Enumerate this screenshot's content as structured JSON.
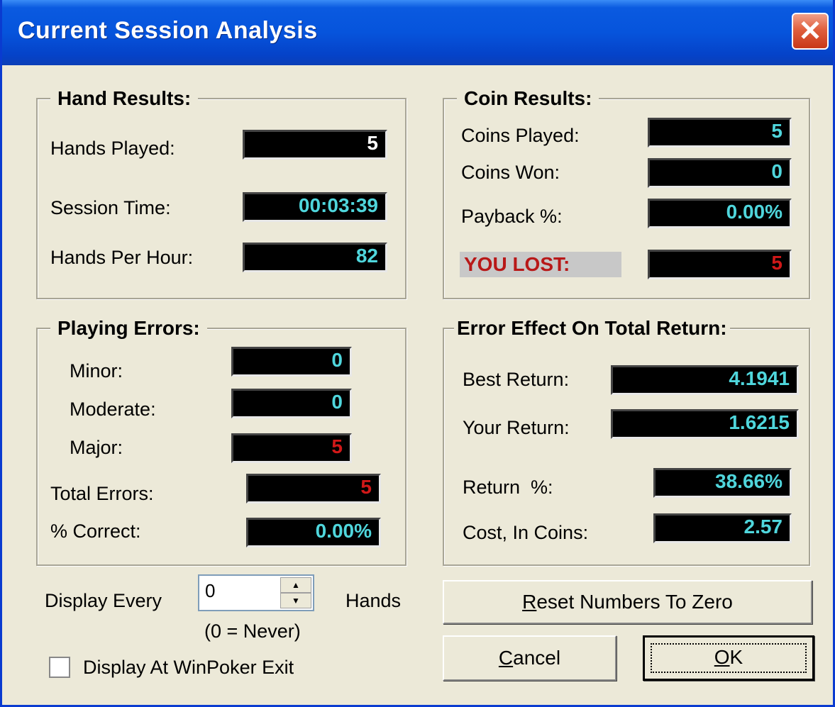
{
  "window": {
    "title": "Current Session Analysis"
  },
  "hand_results": {
    "title": "Hand Results:",
    "hands_played_label": "Hands Played:",
    "hands_played": "5",
    "session_time_label": "Session Time:",
    "session_time": "00:03:39",
    "hands_per_hour_label": "Hands Per Hour:",
    "hands_per_hour": "82"
  },
  "coin_results": {
    "title": "Coin Results:",
    "coins_played_label": "Coins Played:",
    "coins_played": "5",
    "coins_won_label": "Coins Won:",
    "coins_won": "0",
    "payback_label": "Payback %:",
    "payback": "0.00%",
    "you_lost_label": "YOU LOST:",
    "you_lost": "5"
  },
  "playing_errors": {
    "title": "Playing Errors:",
    "minor_label": "Minor:",
    "minor": "0",
    "moderate_label": "Moderate:",
    "moderate": "0",
    "major_label": "Major:",
    "major": "5",
    "total_label": "Total Errors:",
    "total": "5",
    "correct_label": "% Correct:",
    "correct": "0.00%"
  },
  "error_effect": {
    "title": "Error Effect On Total Return:",
    "best_label": "Best Return:",
    "best": "4.1941",
    "your_label": "Your Return:",
    "your": "1.6215",
    "return_pct_label": "Return  %:",
    "return_pct": "38.66%",
    "cost_label": "Cost, In Coins:",
    "cost": "2.57"
  },
  "display": {
    "every_label": "Display Every",
    "every_value": "0",
    "hands_label": "Hands",
    "never_note": "(0 = Never)",
    "exit_label": "Display At WinPoker Exit"
  },
  "buttons": {
    "reset_first": "R",
    "reset_rest": "eset Numbers To Zero",
    "cancel_first": "C",
    "cancel_rest": "ancel",
    "ok_first": "O",
    "ok_rest": "K"
  },
  "colors": {
    "title_bar": "#0654dc",
    "dialog": "#ece9d8",
    "readout_cyan": "#4fd6dc",
    "readout_red": "#d01818"
  }
}
